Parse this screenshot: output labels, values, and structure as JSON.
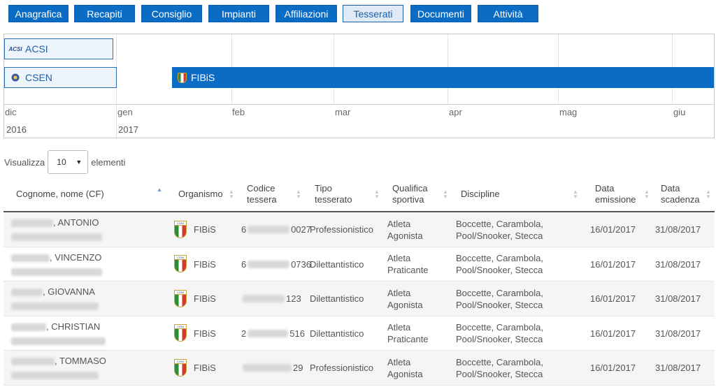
{
  "tabs": [
    {
      "label": "Anagrafica",
      "active": false
    },
    {
      "label": "Recapiti",
      "active": false
    },
    {
      "label": "Consiglio",
      "active": false
    },
    {
      "label": "Impianti",
      "active": false
    },
    {
      "label": "Affiliazioni",
      "active": false
    },
    {
      "label": "Tesserati",
      "active": true
    },
    {
      "label": "Documenti",
      "active": false
    },
    {
      "label": "Attività",
      "active": false
    }
  ],
  "timeline": {
    "organizations": [
      {
        "name": "ACSI",
        "logo_text": "ACSI",
        "icon": "acsi-logo-icon"
      },
      {
        "name": "CSEN",
        "icon": "csen-logo-icon"
      }
    ],
    "bar": {
      "label": "FIBiS",
      "icon": "fibis-shield-icon",
      "color": "#0a6cc4"
    },
    "months": [
      "dic",
      "gen",
      "feb",
      "mar",
      "apr",
      "mag",
      "giu"
    ],
    "years": [
      "2016",
      "2017"
    ]
  },
  "length_menu": {
    "prefix": "Visualizza",
    "value": "10",
    "suffix": "elementi"
  },
  "table": {
    "columns": [
      {
        "line1": "Cognome, nome (CF)",
        "line2": ""
      },
      {
        "line1": "Organismo",
        "line2": ""
      },
      {
        "line1": "Codice",
        "line2": "tessera"
      },
      {
        "line1": "Tipo",
        "line2": "tesserato"
      },
      {
        "line1": "Qualifica",
        "line2": "sportiva"
      },
      {
        "line1": "Discipline",
        "line2": ""
      },
      {
        "line1": "Data",
        "line2": "emissione"
      },
      {
        "line1": "Data",
        "line2": "scadenza"
      }
    ],
    "rows": [
      {
        "name": ", ANTONIO",
        "organismo": "FIBiS",
        "code_prefix": "6",
        "code_suffix": "0027",
        "tipo": "Professionistico",
        "qual1": "Atleta",
        "qual2": "Agonista",
        "disc1": "Boccette, Carambola,",
        "disc2": "Pool/Snooker, Stecca",
        "emissione": "16/01/2017",
        "scadenza": "31/08/2017"
      },
      {
        "name": ", VINCENZO",
        "organismo": "FIBiS",
        "code_prefix": "6",
        "code_suffix": "0736",
        "tipo": "Dilettantistico",
        "qual1": "Atleta",
        "qual2": "Praticante",
        "disc1": "Boccette, Carambola,",
        "disc2": "Pool/Snooker, Stecca",
        "emissione": "16/01/2017",
        "scadenza": "31/08/2017"
      },
      {
        "name": ", GIOVANNA",
        "organismo": "FIBiS",
        "code_prefix": "",
        "code_suffix": "123",
        "tipo": "Dilettantistico",
        "qual1": "Atleta",
        "qual2": "Agonista",
        "disc1": "Boccette, Carambola,",
        "disc2": "Pool/Snooker, Stecca",
        "emissione": "16/01/2017",
        "scadenza": "31/08/2017"
      },
      {
        "name": ", CHRISTIAN",
        "organismo": "FIBiS",
        "code_prefix": "2",
        "code_suffix": "516",
        "tipo": "Dilettantistico",
        "qual1": "Atleta",
        "qual2": "Praticante",
        "disc1": "Boccette, Carambola,",
        "disc2": "Pool/Snooker, Stecca",
        "emissione": "16/01/2017",
        "scadenza": "31/08/2017"
      },
      {
        "name": ", TOMMASO",
        "organismo": "FIBiS",
        "code_prefix": "",
        "code_suffix": "29",
        "tipo": "Professionistico",
        "qual1": "Atleta",
        "qual2": "Agonista",
        "disc1": "Boccette, Carambola,",
        "disc2": "Pool/Snooker, Stecca",
        "emissione": "16/01/2017",
        "scadenza": "31/08/2017"
      }
    ]
  }
}
